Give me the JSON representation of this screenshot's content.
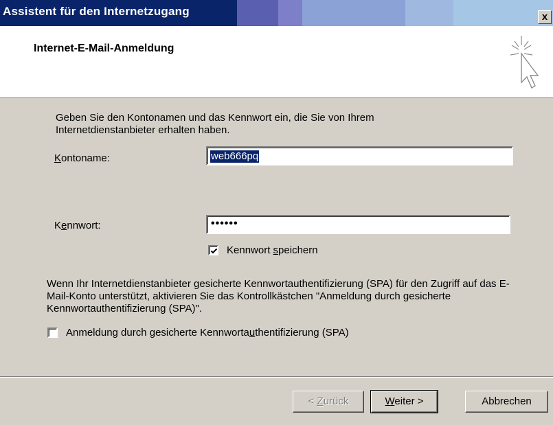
{
  "window": {
    "title": "Assistent für den Internetzugang",
    "close_label": "x"
  },
  "header": {
    "title": "Internet-E-Mail-Anmeldung"
  },
  "intro": "Geben Sie den Kontonamen und das Kennwort ein, die Sie von Ihrem Internetdienstanbieter erhalten haben.",
  "account": {
    "label_pre": "",
    "label_u": "K",
    "label_post": "ontoname:",
    "value": "web666pq"
  },
  "password": {
    "label_pre": "K",
    "label_u": "e",
    "label_post": "nnwort:",
    "value": "••••••"
  },
  "save_password": {
    "label_pre": "Kennwort ",
    "label_u": "s",
    "label_post": "peichern",
    "checked": true
  },
  "spa_info": "Wenn Ihr Internetdienstanbieter gesicherte Kennwortauthentifizierung (SPA) für den Zugriff auf das E-Mail-Konto unterstützt, aktivieren Sie das Kontrollkästchen \"Anmeldung durch gesicherte Kennwortauthentifizierung (SPA)\".",
  "spa_checkbox": {
    "label_pre": "Anmeldung durch gesicherte Kennworta",
    "label_u": "u",
    "label_post": "thentifizierung (SPA)",
    "checked": false
  },
  "buttons": {
    "back": {
      "pre": "< ",
      "u": "Z",
      "post": "urück"
    },
    "next": {
      "pre": "",
      "u": "W",
      "post": "eiter >"
    },
    "cancel": "Abbrechen"
  },
  "colors": {
    "titlebar": "#0a246a",
    "selection": "#0a246a",
    "face": "#d4d0c8"
  }
}
